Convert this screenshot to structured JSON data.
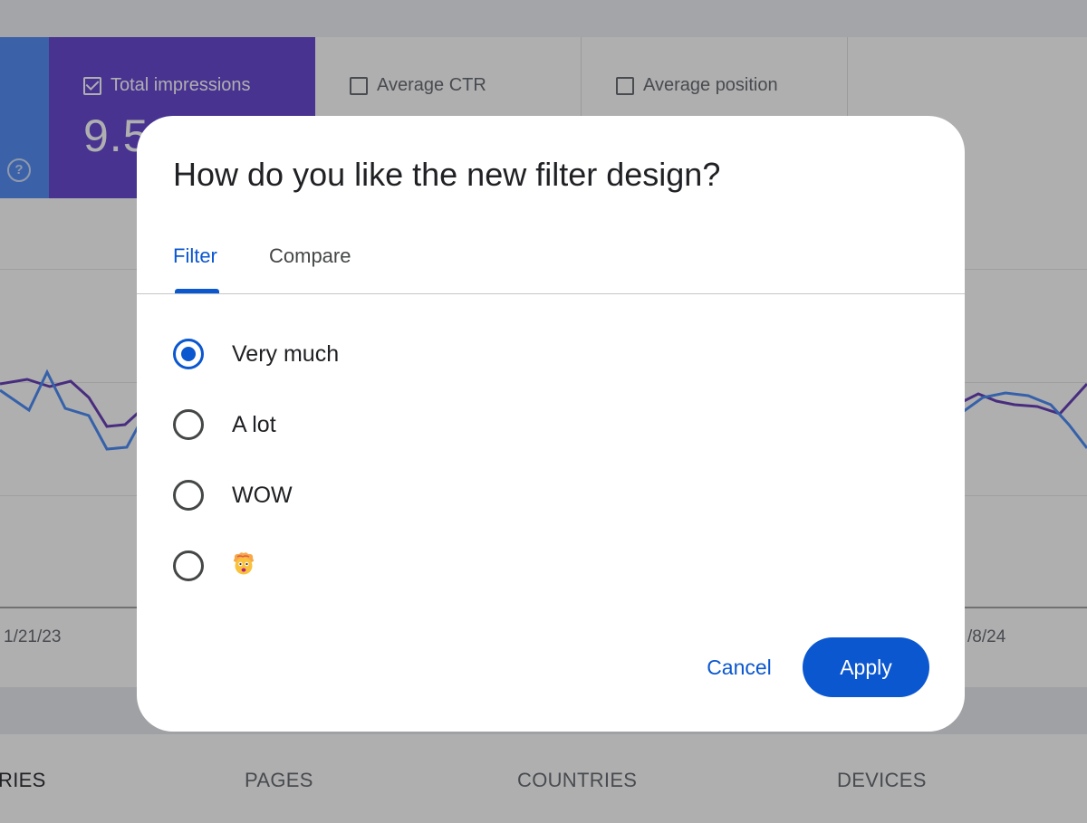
{
  "background": {
    "cards": {
      "impressions_label": "Total impressions",
      "impressions_value": "9.5",
      "ctr_label": "Average CTR",
      "position_label": "Average position",
      "help_glyph": "?"
    },
    "chart": {
      "x_labels": [
        "1/21/23",
        "/8/24"
      ],
      "series_colors": {
        "impressions": "#5e35b1",
        "clicks": "#4285f4"
      }
    },
    "tabs": [
      "RIES",
      "PAGES",
      "COUNTRIES",
      "DEVICES"
    ]
  },
  "dialog": {
    "title": "How do you like the new filter design?",
    "tabs": {
      "filter": "Filter",
      "compare": "Compare"
    },
    "selected_tab": "Filter",
    "options": [
      {
        "label": "Very much",
        "selected": true
      },
      {
        "label": "A lot",
        "selected": false
      },
      {
        "label": "WOW",
        "selected": false
      },
      {
        "label": "🤯",
        "selected": false,
        "icon": "exploding-head-emoji"
      }
    ],
    "buttons": {
      "cancel": "Cancel",
      "apply": "Apply"
    },
    "accent_color": "#0b57d0"
  }
}
